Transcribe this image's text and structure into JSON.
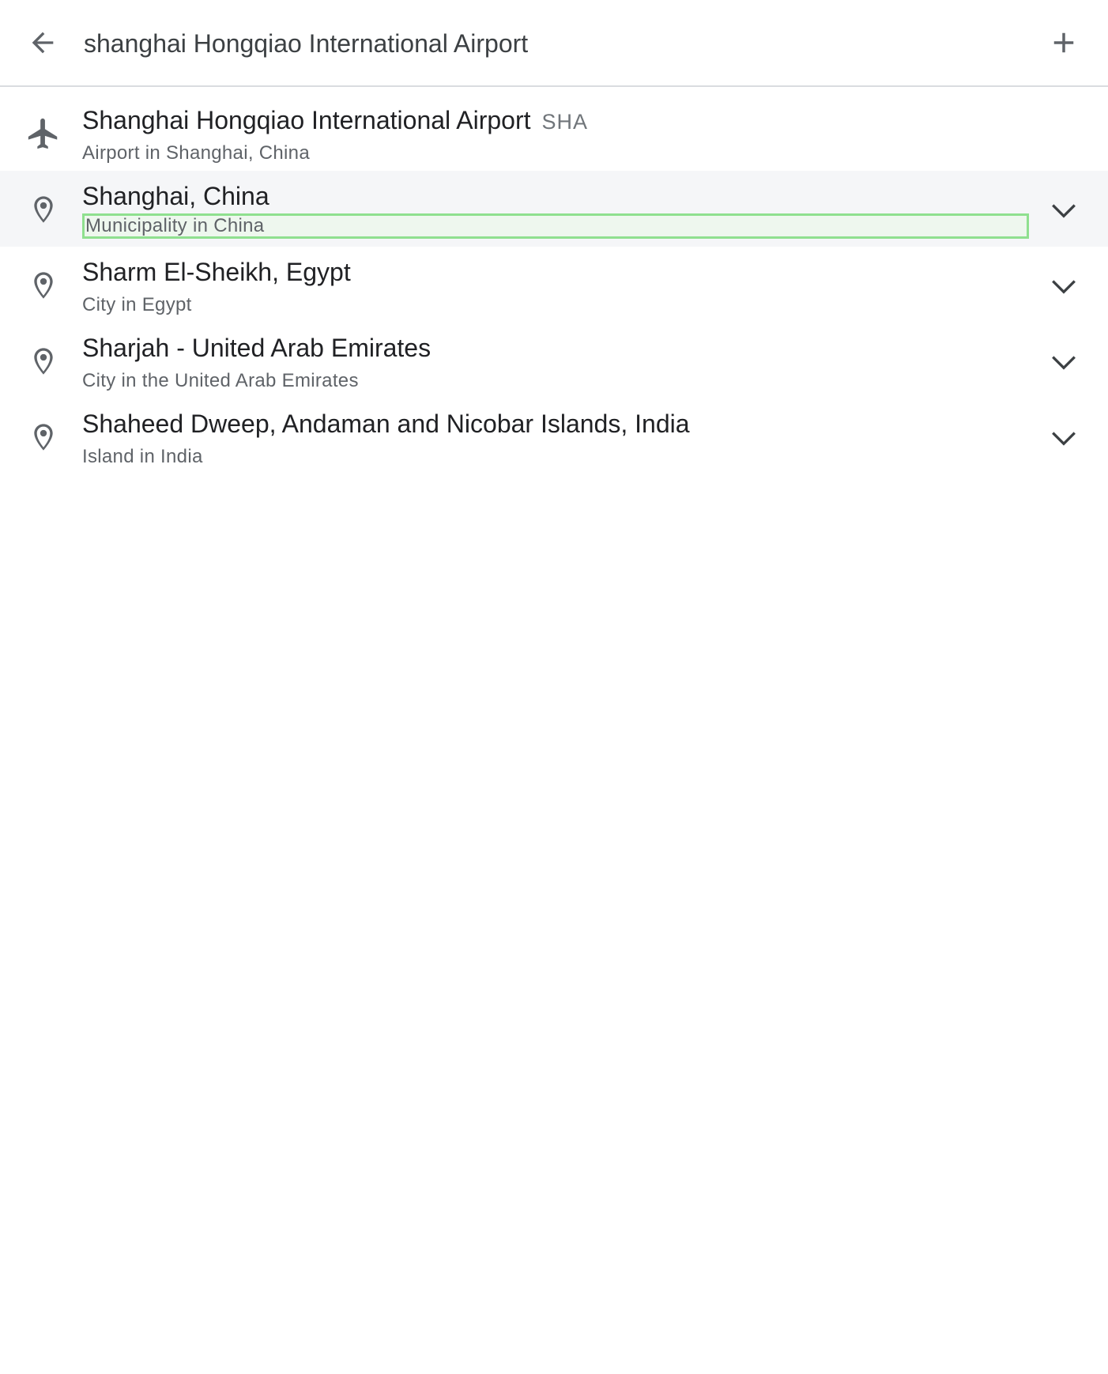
{
  "search": {
    "value": "shanghai Hongqiao International Airport"
  },
  "icons": {
    "back": "arrow-left-icon",
    "add": "plus-icon",
    "airport": "airplane-icon",
    "place": "location-pin-icon",
    "expand": "chevron-down-icon"
  },
  "colors": {
    "icon": "#5f6368",
    "hover_row": "#f5f6f8",
    "focus_outline": "#8fe08f"
  },
  "results": [
    {
      "title": "Shanghai Hongqiao International Airport",
      "code": "SHA",
      "subtitle": "Airport in Shanghai, China"
    },
    {
      "title": "Shanghai, China",
      "subtitle": "Municipality in China"
    },
    {
      "title": "Sharm El-Sheikh, Egypt",
      "subtitle": "City in Egypt"
    },
    {
      "title": "Sharjah - United Arab Emirates",
      "subtitle": "City in the United Arab Emirates"
    },
    {
      "title": "Shaheed Dweep, Andaman and Nicobar Islands, India",
      "subtitle": "Island in India"
    }
  ]
}
